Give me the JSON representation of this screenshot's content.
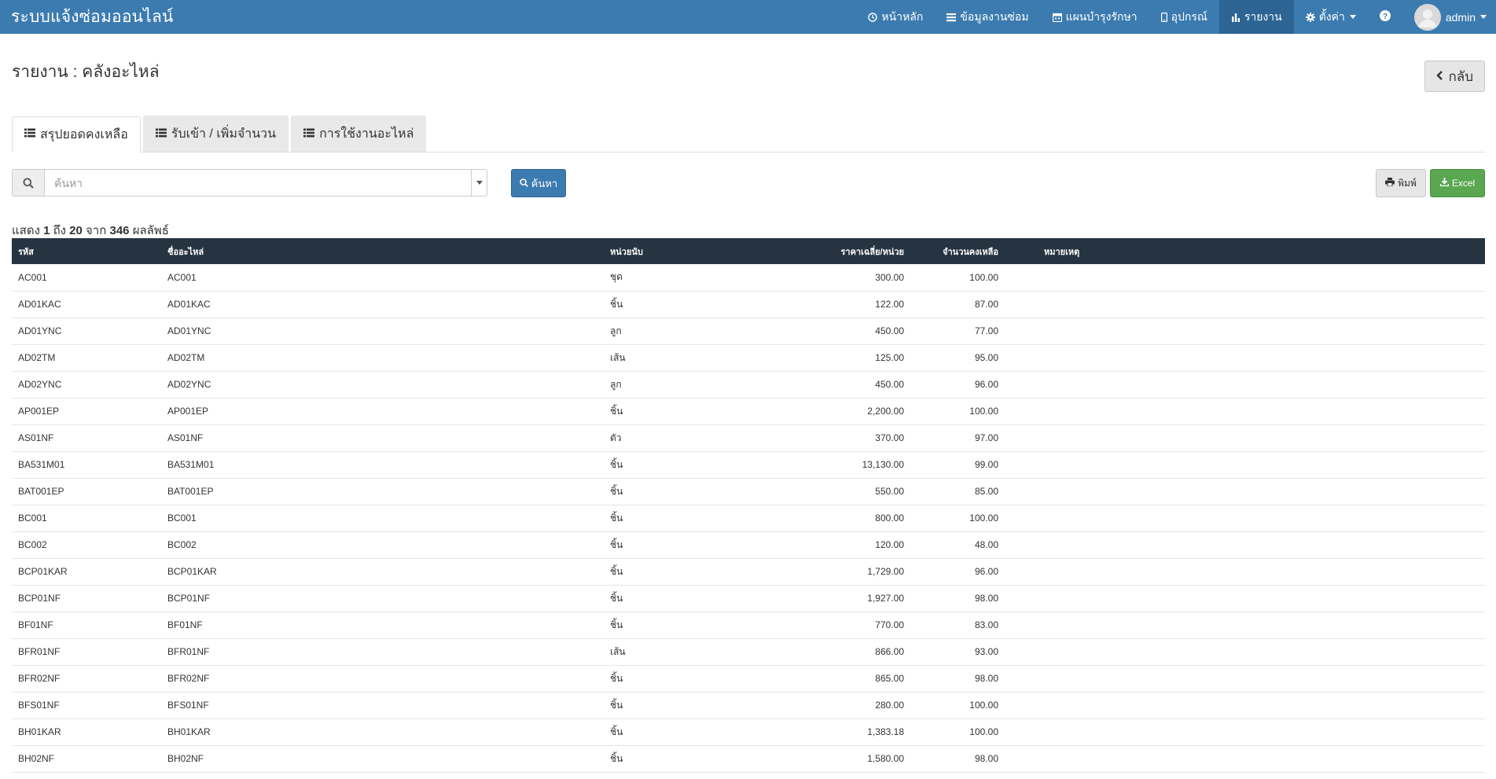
{
  "navbar": {
    "brand": "ระบบแจ้งซ่อมออนไลน์",
    "items": [
      {
        "label": "หน้าหลัก",
        "icon": "clock-icon"
      },
      {
        "label": "ข้อมูลงานซ่อม",
        "icon": "list-icon"
      },
      {
        "label": "แผนบำรุงรักษา",
        "icon": "calendar-icon"
      },
      {
        "label": "อุปกรณ์",
        "icon": "mobile-icon"
      },
      {
        "label": "รายงาน",
        "icon": "bar-chart-icon"
      },
      {
        "label": "ตั้งค่า",
        "icon": "gear-icon"
      }
    ],
    "user": "admin"
  },
  "page": {
    "title": "รายงาน : คลังอะไหล่",
    "back_label": "กลับ"
  },
  "tabs": [
    {
      "label": "สรุปยอดคงเหลือ"
    },
    {
      "label": "รับเข้า / เพิ่มจำนวน"
    },
    {
      "label": "การใช้งานอะไหล่"
    }
  ],
  "search": {
    "placeholder": "ค้นหา",
    "button_label": "ค้นหา"
  },
  "actions": {
    "print_label": "พิมพ์",
    "excel_label": "Excel"
  },
  "summary": {
    "prefix": "แสดง",
    "from": "1",
    "to_word": "ถึง",
    "to": "20",
    "of_word": "จาก",
    "total": "346",
    "suffix": "ผลลัพธ์"
  },
  "table": {
    "headers": [
      "รหัส",
      "ชื่ออะไหล่",
      "หน่วยนับ",
      "ราคาเฉลี่ย/หน่วย",
      "จำนวนคงเหลือ",
      "หมายเหตุ"
    ],
    "rows": [
      [
        "AC001",
        "AC001",
        "ชุด",
        "300.00",
        "100.00",
        ""
      ],
      [
        "AD01KAC",
        "AD01KAC",
        "ชิ้น",
        "122.00",
        "87.00",
        ""
      ],
      [
        "AD01YNC",
        "AD01YNC",
        "ลูก",
        "450.00",
        "77.00",
        ""
      ],
      [
        "AD02TM",
        "AD02TM",
        "เส้น",
        "125.00",
        "95.00",
        ""
      ],
      [
        "AD02YNC",
        "AD02YNC",
        "ลูก",
        "450.00",
        "96.00",
        ""
      ],
      [
        "AP001EP",
        "AP001EP",
        "ชิ้น",
        "2,200.00",
        "100.00",
        ""
      ],
      [
        "AS01NF",
        "AS01NF",
        "ตัว",
        "370.00",
        "97.00",
        ""
      ],
      [
        "BA531M01",
        "BA531M01",
        "ชิ้น",
        "13,130.00",
        "99.00",
        ""
      ],
      [
        "BAT001EP",
        "BAT001EP",
        "ชิ้น",
        "550.00",
        "85.00",
        ""
      ],
      [
        "BC001",
        "BC001",
        "ชิ้น",
        "800.00",
        "100.00",
        ""
      ],
      [
        "BC002",
        "BC002",
        "ชิ้น",
        "120.00",
        "48.00",
        ""
      ],
      [
        "BCP01KAR",
        "BCP01KAR",
        "ชิ้น",
        "1,729.00",
        "96.00",
        ""
      ],
      [
        "BCP01NF",
        "BCP01NF",
        "ชิ้น",
        "1,927.00",
        "98.00",
        ""
      ],
      [
        "BF01NF",
        "BF01NF",
        "ชิ้น",
        "770.00",
        "83.00",
        ""
      ],
      [
        "BFR01NF",
        "BFR01NF",
        "เส้น",
        "866.00",
        "93.00",
        ""
      ],
      [
        "BFR02NF",
        "BFR02NF",
        "ชิ้น",
        "865.00",
        "98.00",
        ""
      ],
      [
        "BFS01NF",
        "BFS01NF",
        "ชิ้น",
        "280.00",
        "100.00",
        ""
      ],
      [
        "BH01KAR",
        "BH01KAR",
        "ชิ้น",
        "1,383.18",
        "100.00",
        ""
      ],
      [
        "BH02NF",
        "BH02NF",
        "ชิ้น",
        "1,580.00",
        "98.00",
        ""
      ]
    ]
  }
}
